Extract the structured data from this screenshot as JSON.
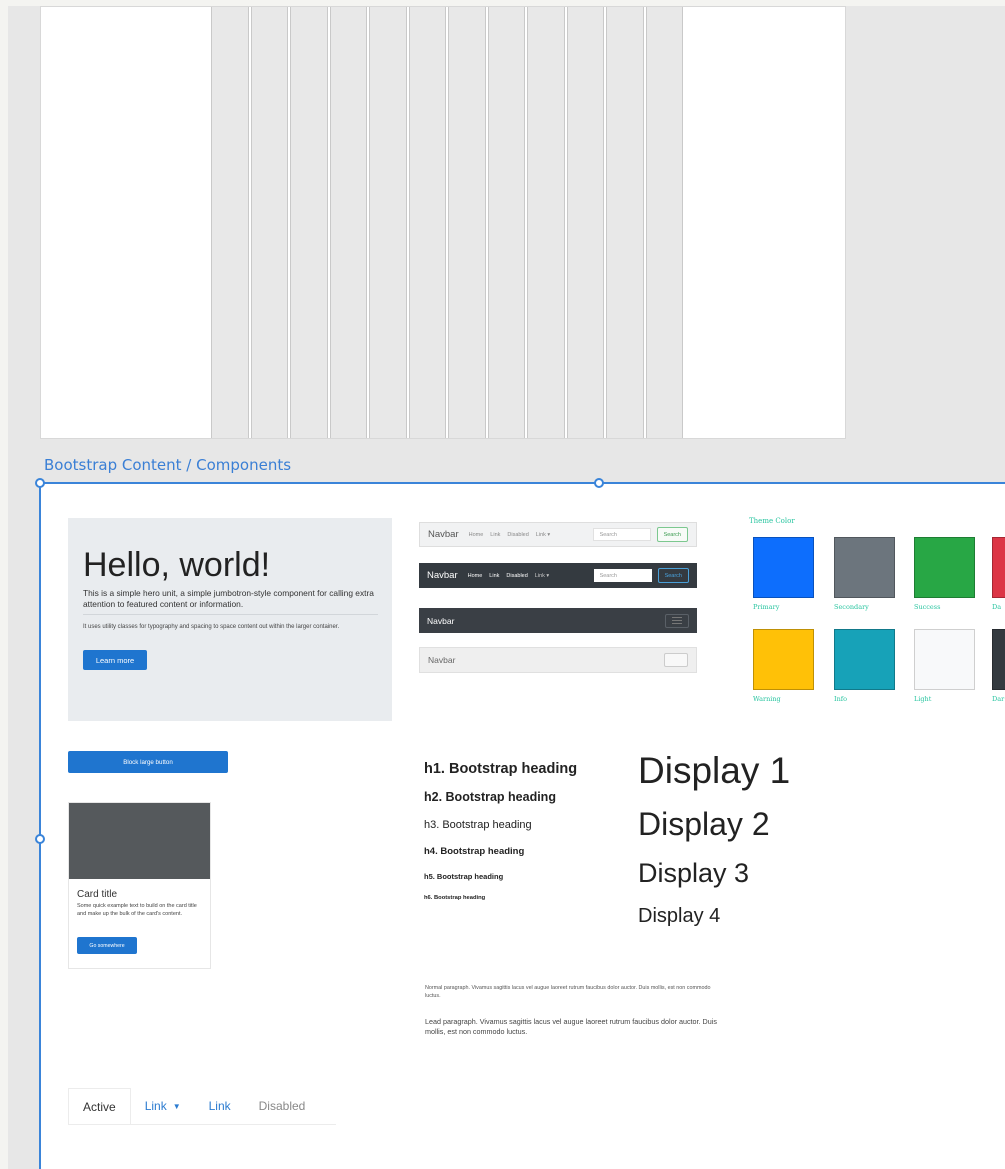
{
  "artboard": {
    "title": "Bootstrap Content / Components"
  },
  "grid": {
    "column_count": 12
  },
  "jumbotron": {
    "heading": "Hello, world!",
    "lead": "This is a simple hero unit, a simple jumbotron-style component for calling extra attention to featured content or information.",
    "text": "It uses utility classes for typography and spacing to space content out within the larger container.",
    "button": "Learn more"
  },
  "navbars": {
    "light": {
      "brand": "Navbar",
      "links": [
        "Home",
        "Link",
        "Disabled",
        "Link ▾"
      ],
      "search_placeholder": "Search",
      "search_button": "Search"
    },
    "dark": {
      "brand": "Navbar",
      "links": [
        "Home",
        "Link",
        "Disabled",
        "Link ▾"
      ],
      "search_placeholder": "Search",
      "search_button": "Search"
    },
    "collapsed_dark": {
      "brand": "Navbar"
    },
    "collapsed_light": {
      "brand": "Navbar"
    }
  },
  "theme": {
    "title": "Theme Color",
    "colors": [
      {
        "name": "Primary",
        "hex": "#0d6efd"
      },
      {
        "name": "Secondary",
        "hex": "#6c757d"
      },
      {
        "name": "Success",
        "hex": "#28a745"
      },
      {
        "name": "Da",
        "hex": "#dc3545"
      },
      {
        "name": "Warning",
        "hex": "#ffc107"
      },
      {
        "name": "Info",
        "hex": "#17a2b8"
      },
      {
        "name": "Light",
        "hex": "#f8f9fa"
      },
      {
        "name": "Dar",
        "hex": "#343a40"
      }
    ]
  },
  "block_button": "Block large button",
  "card": {
    "title": "Card title",
    "text": "Some quick example text to build on the card title and make up the bulk of the card's content.",
    "button": "Go somewhere"
  },
  "headings": [
    "h1. Bootstrap heading",
    "h2. Bootstrap heading",
    "h3. Bootstrap heading",
    "h4. Bootstrap heading",
    "h5. Bootstrap heading",
    "h6. Bootstrap heading"
  ],
  "displays": [
    "Display 1",
    "Display 2",
    "Display 3",
    "Display 4"
  ],
  "paragraphs": {
    "normal": "Normal paragraph. Vivamus sagittis lacus vel augue laoreet rutrum faucibus dolor auctor. Duis mollis, est non commodo luctus.",
    "lead": "Lead paragraph. Vivamus sagittis lacus vel augue laoreet rutrum faucibus dolor auctor. Duis mollis, est non commodo luctus."
  },
  "nav": {
    "active": "Active",
    "dropdown": "Link",
    "link": "Link",
    "disabled": "Disabled"
  }
}
